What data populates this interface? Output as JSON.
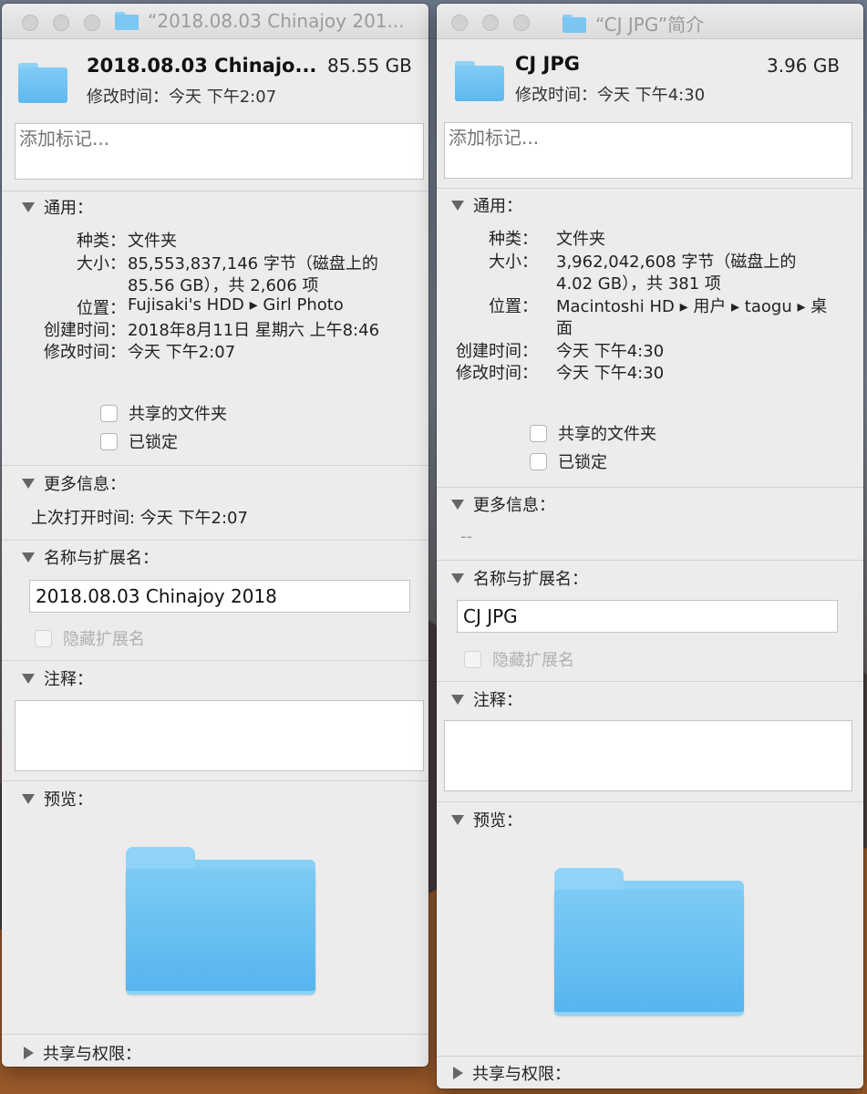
{
  "left": {
    "title": "“2018.08.03 Chinajoy 201...",
    "name": "2018.08.03 Chinajo...",
    "size": "85.55 GB",
    "modified": "修改时间：今天 下午2:07",
    "tags_placeholder": "添加标记...",
    "general": {
      "heading": "通用：",
      "kind_label": "种类：",
      "kind": "文件夹",
      "size_label": "大小：",
      "size_line1": "85,553,837,146 字节（磁盘上的",
      "size_line2": "85.56 GB），共 2,606 项",
      "where_label": "位置：",
      "where": "Fujisaki's HDD ▸ Girl Photo",
      "created_label": "创建时间：",
      "created": "2018年8月11日 星期六 上午8:46",
      "modified_label": "修改时间：",
      "modified": "今天 下午2:07",
      "shared_label": "共享的文件夹",
      "locked_label": "已锁定"
    },
    "more_info": {
      "heading": "更多信息：",
      "text": "上次打开时间: 今天 下午2:07"
    },
    "name_ext": {
      "heading": "名称与扩展名：",
      "value": "2018.08.03 Chinajoy 2018",
      "hide_label": "隐藏扩展名"
    },
    "comments": {
      "heading": "注释："
    },
    "preview": {
      "heading": "预览："
    },
    "sharing": {
      "heading": "共享与权限："
    }
  },
  "right": {
    "title": "“CJ JPG”简介",
    "name": "CJ JPG",
    "size": "3.96 GB",
    "modified": "修改时间：今天 下午4:30",
    "tags_placeholder": "添加标记...",
    "general": {
      "heading": "通用：",
      "kind_label": "种类：",
      "kind": "文件夹",
      "size_label": "大小：",
      "size_line1": "3,962,042,608 字节（磁盘上的",
      "size_line2": "4.02 GB），共 381 项",
      "where_label": "位置：",
      "where_line1": "Macintoshi HD ▸ 用户 ▸ taogu ▸ 桌",
      "where_line2": "面",
      "created_label": "创建时间：",
      "created": "今天 下午4:30",
      "modified_label": "修改时间：",
      "modified": "今天 下午4:30",
      "shared_label": "共享的文件夹",
      "locked_label": "已锁定"
    },
    "more_info": {
      "heading": "更多信息：",
      "text": "--"
    },
    "name_ext": {
      "heading": "名称与扩展名：",
      "value": "CJ JPG",
      "hide_label": "隐藏扩展名"
    },
    "comments": {
      "heading": "注释："
    },
    "preview": {
      "heading": "预览："
    },
    "sharing": {
      "heading": "共享与权限："
    }
  }
}
